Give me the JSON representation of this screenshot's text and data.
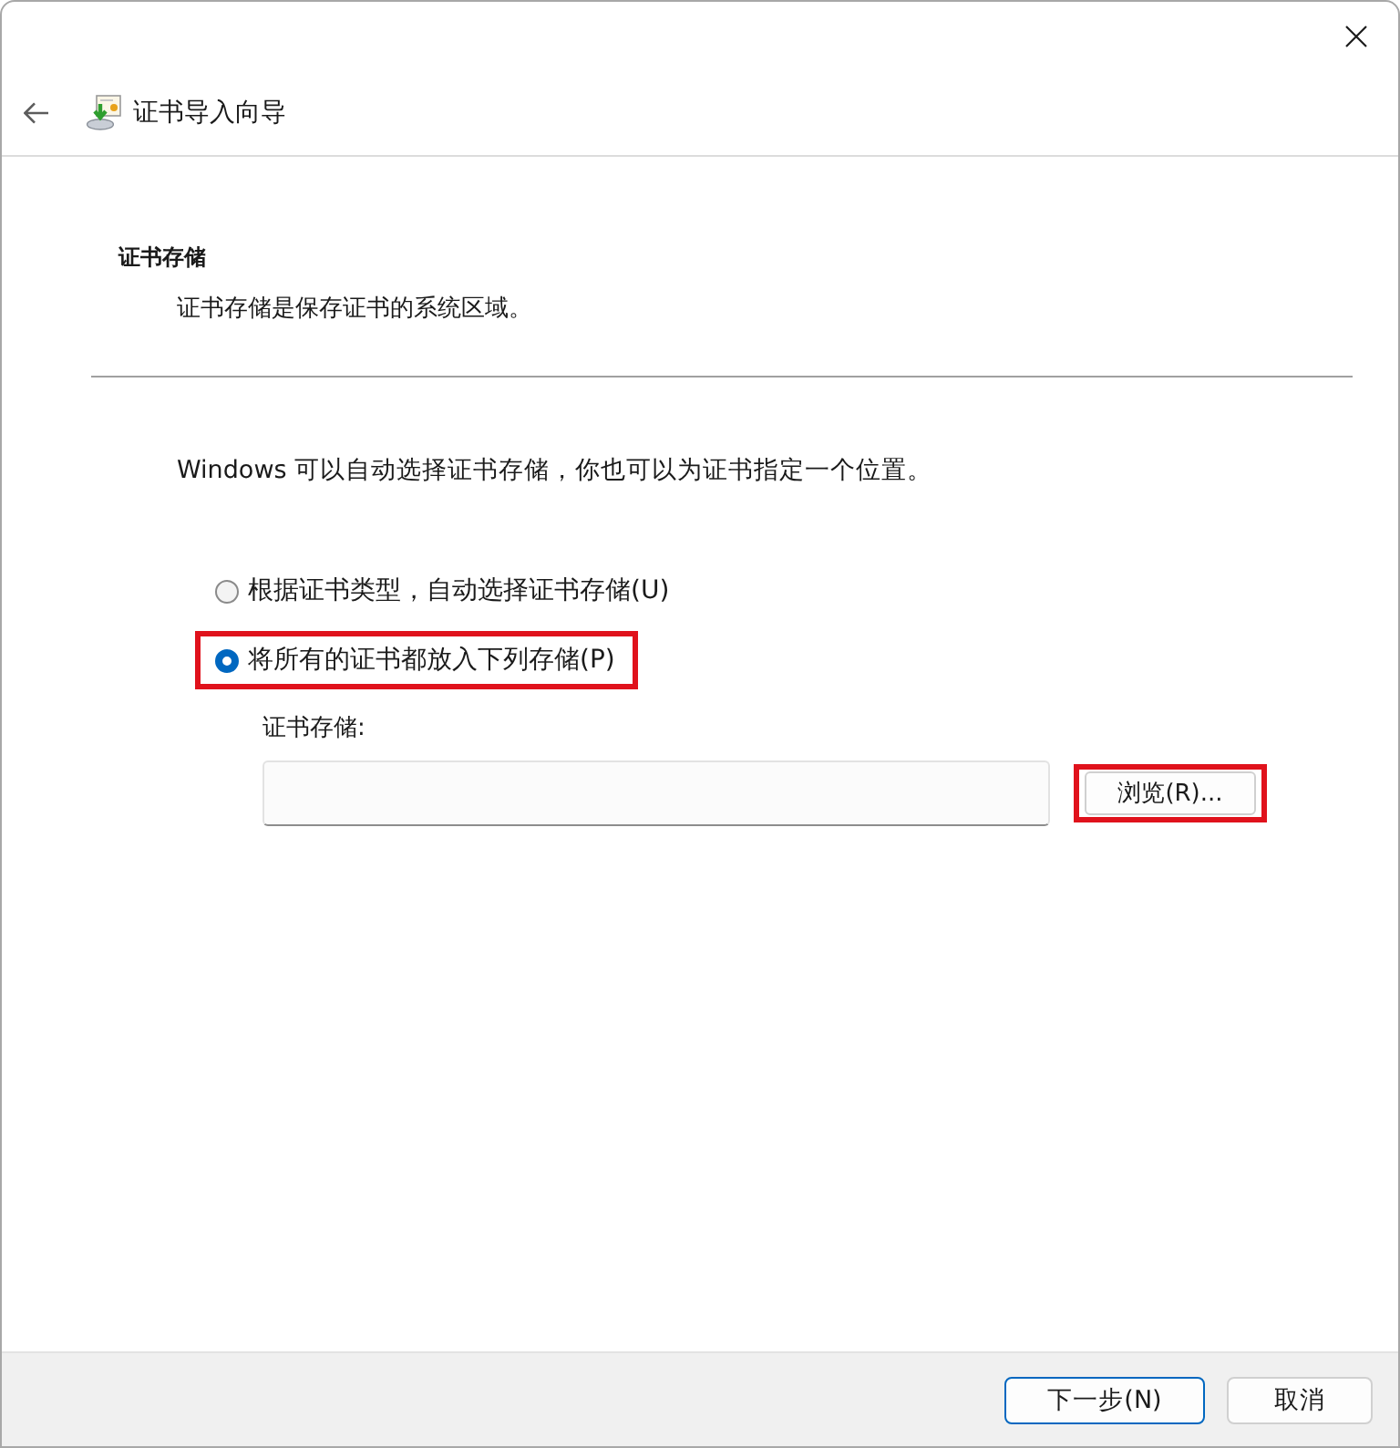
{
  "window": {
    "title": "证书导入向导"
  },
  "section": {
    "heading": "证书存储",
    "description": "证书存储是保存证书的系统区域。"
  },
  "intro": "Windows 可以自动选择证书存储，你也可以为证书指定一个位置。",
  "options": [
    {
      "label": "根据证书类型，自动选择证书存储(U)",
      "selected": false,
      "highlighted": false
    },
    {
      "label": "将所有的证书都放入下列存储(P)",
      "selected": true,
      "highlighted": true
    }
  ],
  "store": {
    "label": "证书存储:",
    "browse_button": {
      "label": "浏览(R)...",
      "highlighted": true
    }
  },
  "footer_buttons": [
    {
      "label": "下一步(N)",
      "default": true
    },
    {
      "label": "取消",
      "default": false
    }
  ]
}
